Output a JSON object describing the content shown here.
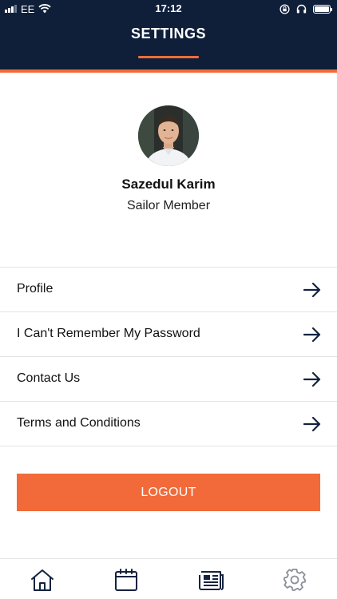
{
  "status_bar": {
    "carrier": "EE",
    "time": "17:12"
  },
  "header": {
    "title": "SETTINGS"
  },
  "profile": {
    "name": "Sazedul Karim",
    "role": "Sailor Member"
  },
  "menu": {
    "items": [
      {
        "label": "Profile",
        "icon": "arrow-right-icon"
      },
      {
        "label": "I Can't Remember My Password",
        "icon": "arrow-right-icon"
      },
      {
        "label": "Contact Us",
        "icon": "arrow-right-icon"
      },
      {
        "label": "Terms and Conditions",
        "icon": "arrow-right-icon"
      }
    ]
  },
  "logout": {
    "label": "LOGOUT"
  },
  "tabbar": {
    "tabs": [
      {
        "icon": "home-icon",
        "active": false
      },
      {
        "icon": "calendar-icon",
        "active": false
      },
      {
        "icon": "newspaper-icon",
        "active": false
      },
      {
        "icon": "gear-icon",
        "active": true
      }
    ]
  },
  "colors": {
    "header_bg": "#0f1f3a",
    "accent": "#ef6c3b",
    "logout_bg": "#f26a3a",
    "icon_dark": "#13233f",
    "icon_inactive": "#8a8f99"
  }
}
